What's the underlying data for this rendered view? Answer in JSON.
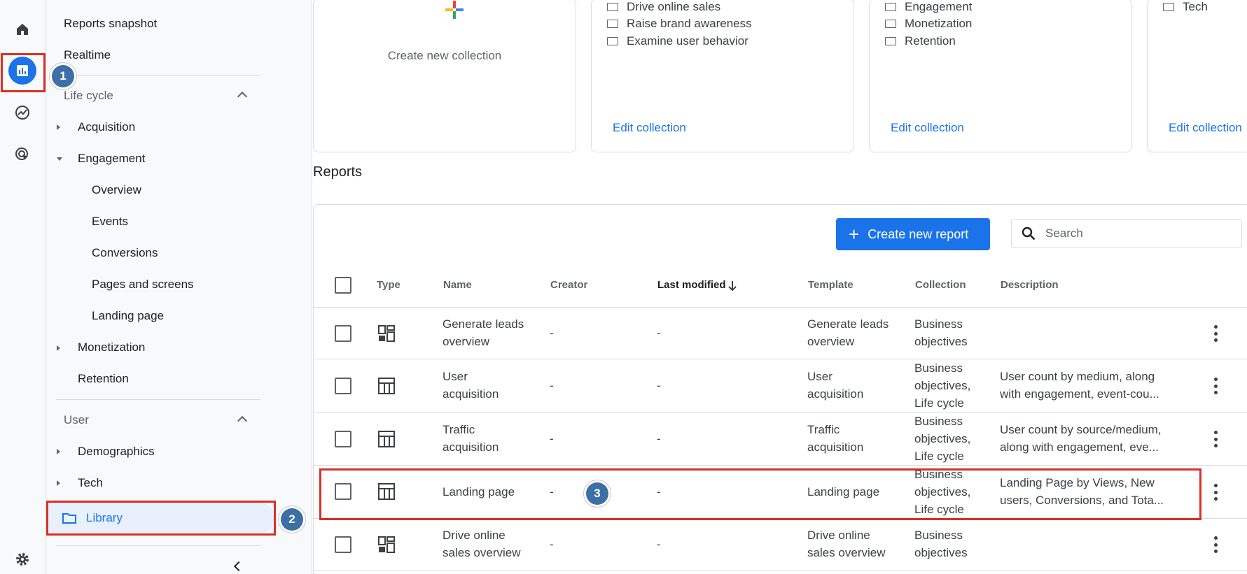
{
  "rail": {
    "icons": [
      "home-icon",
      "reports-icon",
      "explore-icon",
      "advertising-icon",
      "settings-icon"
    ]
  },
  "sidebar": {
    "reports_snapshot": "Reports snapshot",
    "realtime": "Realtime",
    "life_cycle": "Life cycle",
    "acquisition": "Acquisition",
    "engagement": "Engagement",
    "overview": "Overview",
    "events": "Events",
    "conversions": "Conversions",
    "pages_and_screens": "Pages and screens",
    "landing_page": "Landing page",
    "monetization": "Monetization",
    "retention": "Retention",
    "user": "User",
    "demographics": "Demographics",
    "tech": "Tech",
    "library": "Library"
  },
  "annotations": {
    "one": "1",
    "two": "2",
    "three": "3"
  },
  "collections": {
    "create_new": "Create new collection",
    "card1": {
      "items": [
        "Drive online sales",
        "Raise brand awareness",
        "Examine user behavior"
      ],
      "edit": "Edit collection"
    },
    "card2": {
      "items": [
        "Engagement",
        "Monetization",
        "Retention"
      ],
      "edit": "Edit collection"
    },
    "card3": {
      "items": [
        "Tech"
      ],
      "edit": "Edit collection"
    }
  },
  "reports": {
    "title": "Reports",
    "create_button": "Create new report",
    "search_placeholder": "Search",
    "columns": {
      "type": "Type",
      "name": "Name",
      "creator": "Creator",
      "last_modified": "Last modified",
      "template": "Template",
      "collection": "Collection",
      "description": "Description"
    },
    "rows": [
      {
        "type": "overview",
        "name": [
          "Generate leads",
          "overview"
        ],
        "creator": "-",
        "modified": "-",
        "template": [
          "Generate leads",
          "overview"
        ],
        "collection": [
          "Business",
          "objectives"
        ],
        "description": []
      },
      {
        "type": "detail",
        "name": [
          "User",
          "acquisition"
        ],
        "creator": "-",
        "modified": "-",
        "template": [
          "User",
          "acquisition"
        ],
        "collection": [
          "Business",
          "objectives,",
          "Life cycle"
        ],
        "description": [
          "User count by medium, along",
          "with engagement, event-cou..."
        ]
      },
      {
        "type": "detail",
        "name": [
          "Traffic",
          "acquisition"
        ],
        "creator": "-",
        "modified": "-",
        "template": [
          "Traffic",
          "acquisition"
        ],
        "collection": [
          "Business",
          "objectives,",
          "Life cycle"
        ],
        "description": [
          "User count by source/medium,",
          "along with engagement, eve..."
        ]
      },
      {
        "type": "detail",
        "name": [
          "Landing page"
        ],
        "creator": "-",
        "modified": "-",
        "template": [
          "Landing page"
        ],
        "collection": [
          "Business",
          "objectives,",
          "Life cycle"
        ],
        "description": [
          "Landing Page by Views, New",
          "users, Conversions, and Tota..."
        ]
      },
      {
        "type": "overview",
        "name": [
          "Drive online",
          "sales overview"
        ],
        "creator": "-",
        "modified": "-",
        "template": [
          "Drive online",
          "sales overview"
        ],
        "collection": [
          "Business",
          "objectives"
        ],
        "description": []
      }
    ]
  }
}
